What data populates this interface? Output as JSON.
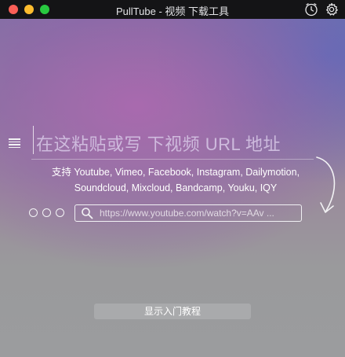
{
  "window": {
    "title": "PullTube - 视频 下载工具"
  },
  "prompt": {
    "text": "在这粘贴或写 下视频 URL 地址"
  },
  "support": {
    "line1": "支持 Youtube, Vimeo, Facebook, Instagram, Dailymotion,",
    "line2": "Soundcloud, Mixcloud, Bandcamp, Youku, IQY"
  },
  "search": {
    "placeholder": "https://www.youtube.com/watch?v=AAv ..."
  },
  "tutorial": {
    "label": "显示入门教程"
  },
  "colors": {
    "close": "#fc5f57",
    "minimize": "#fdbc2e",
    "maximize": "#28c840"
  }
}
